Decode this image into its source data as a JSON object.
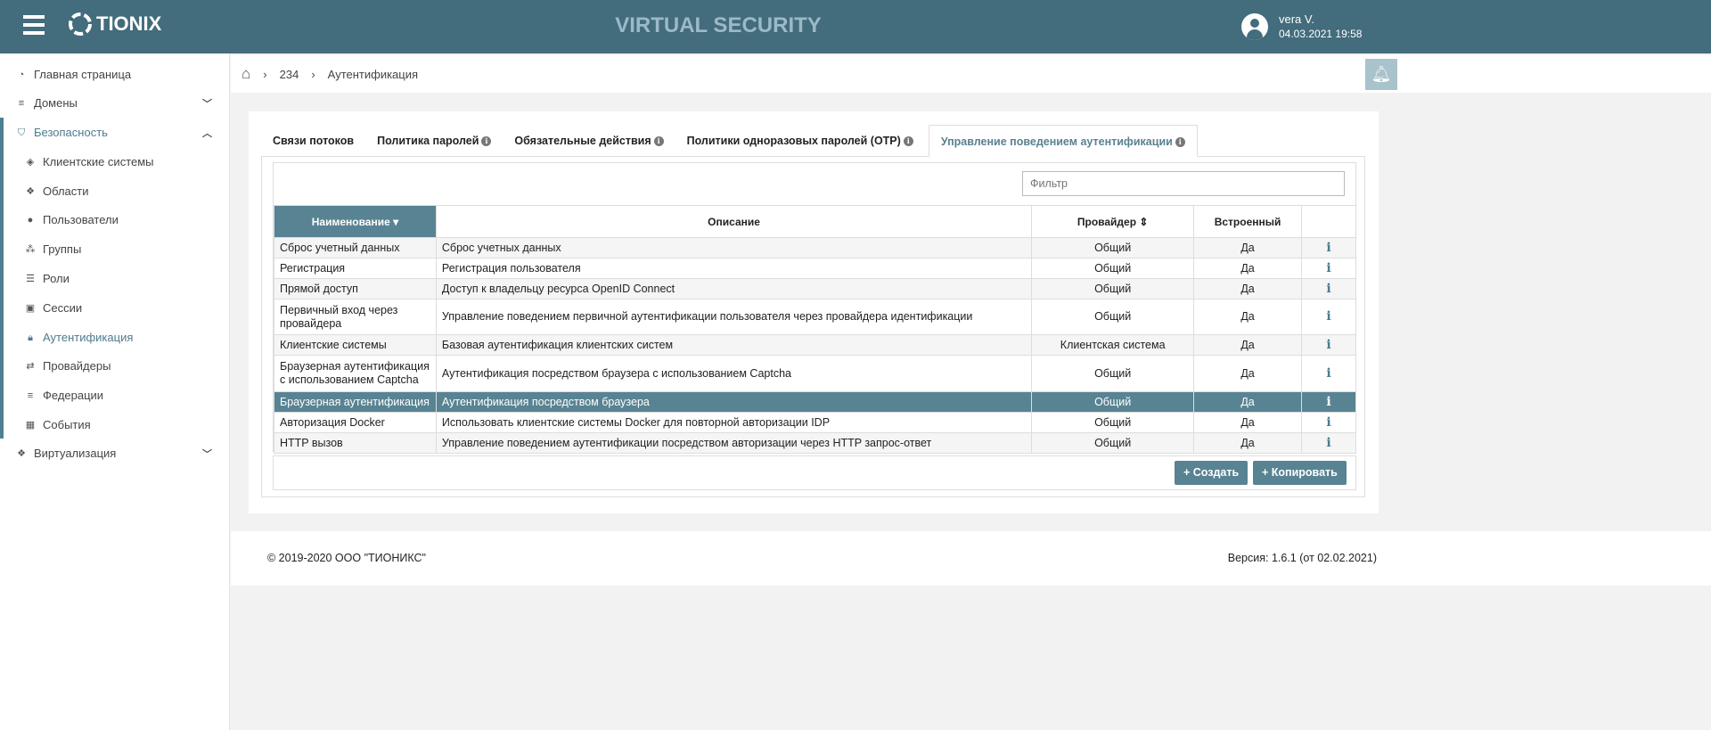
{
  "header": {
    "brand": "TIONIX",
    "title": "VIRTUAL SECURITY",
    "user_name": "vera V.",
    "datetime": "04.03.2021 19:58"
  },
  "sidebar": {
    "items": [
      {
        "label": "Главная страница",
        "icon": "dashboard-icon"
      },
      {
        "label": "Домены",
        "icon": "database-icon"
      },
      {
        "label": "Безопасность",
        "icon": "shield-icon"
      },
      {
        "label": "Клиентские системы",
        "icon": "cube-icon"
      },
      {
        "label": "Области",
        "icon": "cubes-icon"
      },
      {
        "label": "Пользователи",
        "icon": "user-icon"
      },
      {
        "label": "Группы",
        "icon": "users-icon"
      },
      {
        "label": "Роли",
        "icon": "list-icon"
      },
      {
        "label": "Сессии",
        "icon": "id-card-icon"
      },
      {
        "label": "Аутентификация",
        "icon": "lock-icon"
      },
      {
        "label": "Провайдеры",
        "icon": "exchange-icon"
      },
      {
        "label": "Федерации",
        "icon": "database-icon"
      },
      {
        "label": "События",
        "icon": "calendar-check-icon"
      },
      {
        "label": "Виртуализация",
        "icon": "cubes-icon"
      }
    ]
  },
  "breadcrumb": [
    "234",
    "Аутентификация"
  ],
  "tabs": [
    "Связи потоков",
    "Политика паролей",
    "Обязательные действия",
    "Политики одноразовых паролей (OTP)",
    "Управление поведением аутентификации"
  ],
  "filter": {
    "placeholder": "Фильтр"
  },
  "table": {
    "columns": [
      "Наименование",
      "Описание",
      "Провайдер",
      "Встроенный"
    ],
    "rows": [
      {
        "name": "Сброс учетный данных",
        "desc": "Сброс учетных данных",
        "provider": "Общий",
        "builtin": "Да"
      },
      {
        "name": "Регистрация",
        "desc": "Регистрация пользователя",
        "provider": "Общий",
        "builtin": "Да"
      },
      {
        "name": "Прямой доступ",
        "desc": "Доступ к владельцу ресурса OpenID Connect",
        "provider": "Общий",
        "builtin": "Да"
      },
      {
        "name": "Первичный вход через провайдера",
        "desc": "Управление поведением первичной аутентификации пользователя через провайдера идентификации",
        "provider": "Общий",
        "builtin": "Да"
      },
      {
        "name": "Клиентские системы",
        "desc": "Базовая аутентификация клиентских систем",
        "provider": "Клиентская система",
        "builtin": "Да"
      },
      {
        "name": "Браузерная аутентификация с использованием Captcha",
        "desc": "Аутентификация посредством браузера с использованием Captcha",
        "provider": "Общий",
        "builtin": "Да"
      },
      {
        "name": "Браузерная аутентификация",
        "desc": "Аутентификация посредством браузера",
        "provider": "Общий",
        "builtin": "Да"
      },
      {
        "name": "Авторизация Docker",
        "desc": "Использовать клиентские системы Docker для повторной авторизации IDP",
        "provider": "Общий",
        "builtin": "Да"
      },
      {
        "name": "HTTP вызов",
        "desc": "Управление поведением аутентификации посредством авторизации через HTTP запрос-ответ",
        "provider": "Общий",
        "builtin": "Да"
      }
    ]
  },
  "buttons": {
    "create": "+ Создать",
    "copy": "+ Копировать"
  },
  "footer": {
    "copyright": "© 2019-2020 ООО \"ТИОНИКС\"",
    "version": "Версия: 1.6.1 (от 02.02.2021)"
  },
  "colors": {
    "header": "#436c7d",
    "accent": "#588393"
  }
}
